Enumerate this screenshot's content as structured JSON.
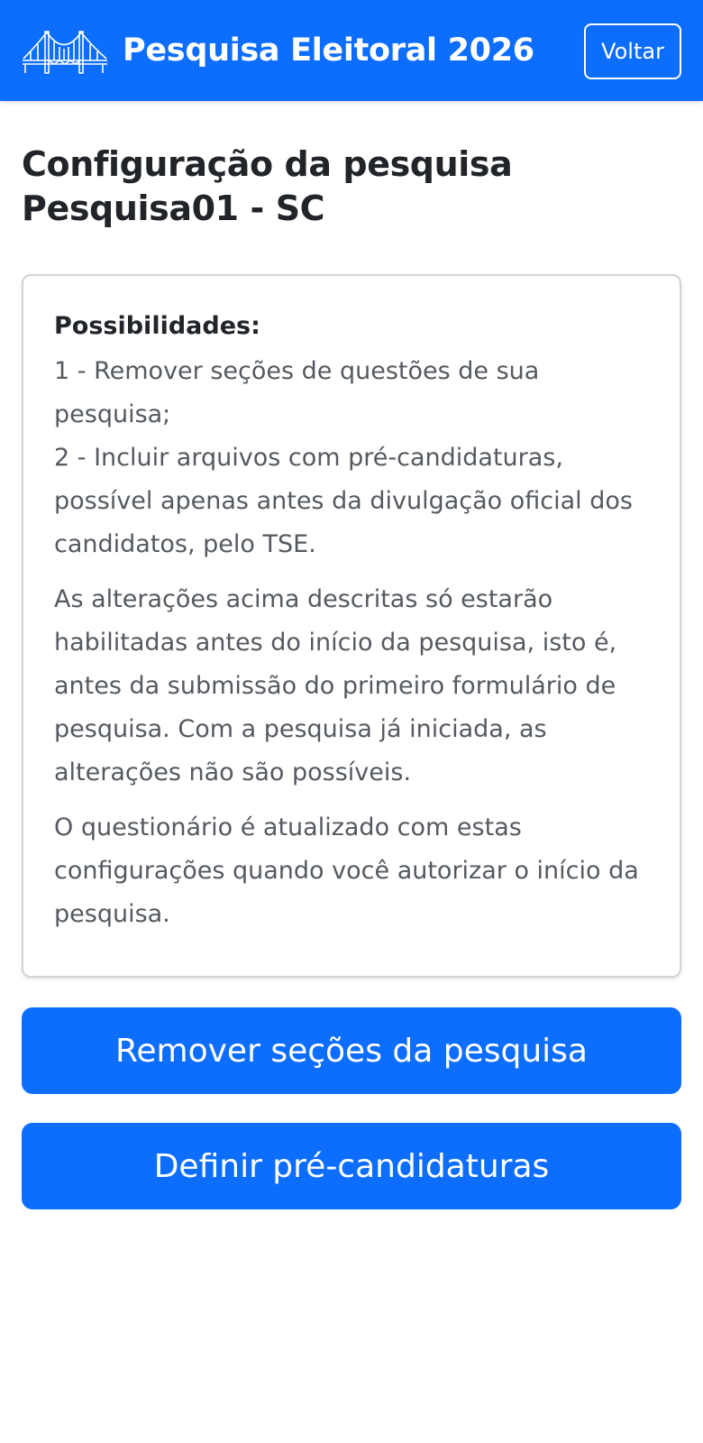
{
  "header": {
    "logo_icon": "bridge-logo-icon",
    "title": "Pesquisa Eleitoral 2026",
    "back_label": "Voltar"
  },
  "main": {
    "title": "Configuração da pesquisa Pesquisa01 - SC",
    "info_card": {
      "heading": "Possibilidades:",
      "items": [
        "1 - Remover seções de questões de sua pesquisa;",
        "2 - Incluir arquivos com pré-candidaturas, possível apenas antes da divulgação oficial dos candidatos, pelo TSE."
      ],
      "paragraphs": [
        "As alterações acima descritas só estarão habilitadas antes do início da pesquisa, isto é, antes da submissão do primeiro formulário de pesquisa. Com a pesquisa já iniciada, as alterações não são possíveis.",
        "O questionário é atualizado com estas configurações quando você autorizar o início da pesquisa."
      ]
    },
    "actions": {
      "remove_sections_label": "Remover seções da pesquisa",
      "define_precandidacies_label": "Definir pré-candidaturas"
    }
  },
  "colors": {
    "primary": "#0d6efd",
    "text": "#212529",
    "muted_text": "#545a60",
    "card_border": "#d3d3d3"
  }
}
